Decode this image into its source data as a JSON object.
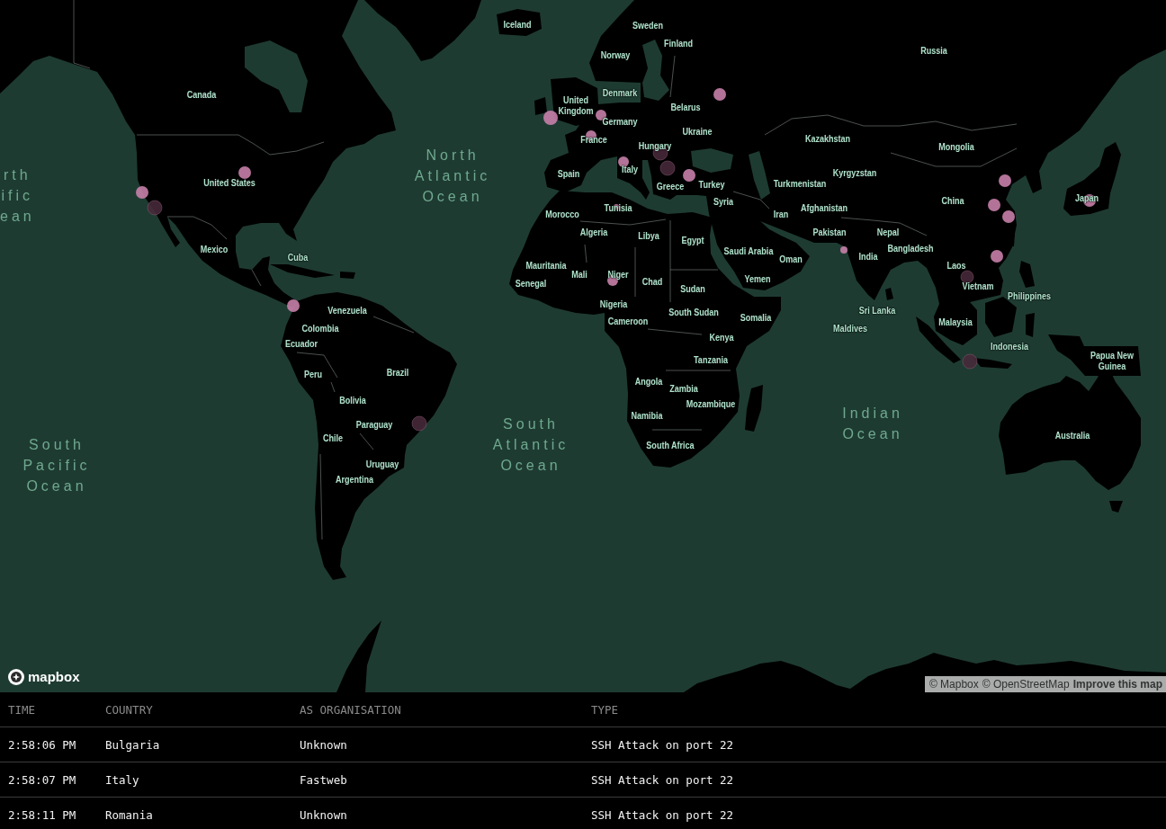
{
  "map": {
    "ocean_labels": [
      "rth ific ean",
      "North Atlantic Ocean",
      "South Pacific Ocean",
      "South Atlantic Ocean",
      "Indian Ocean"
    ],
    "country_labels": [
      "Iceland",
      "Sweden",
      "Finland",
      "Norway",
      "Russia",
      "Canada",
      "Denmark",
      "United Kingdom",
      "Belarus",
      "Germany",
      "Ukraine",
      "France",
      "Kazakhstan",
      "Hungary",
      "Mongolia",
      "Spain",
      "Italy",
      "Kyrgyzstan",
      "United States",
      "Greece",
      "Turkey",
      "Turkmenistan",
      "Syria",
      "China",
      "Japan",
      "Tunisia",
      "Afghanistan",
      "Morocco",
      "Iran",
      "Algeria",
      "Libya",
      "Pakistan",
      "Nepal",
      "Egypt",
      "Mexico",
      "Saudi Arabia",
      "Bangladesh",
      "Cuba",
      "Oman",
      "India",
      "Mauritania",
      "Laos",
      "Mali",
      "Niger",
      "Senegal",
      "Chad",
      "Yemen",
      "Sudan",
      "Vietnam",
      "Philippines",
      "Nigeria",
      "Venezuela",
      "South Sudan",
      "Sri Lanka",
      "Cameroon",
      "Somalia",
      "Malaysia",
      "Colombia",
      "Maldives",
      "Kenya",
      "Ecuador",
      "Indonesia",
      "Tanzania",
      "Papua New Guinea",
      "Peru",
      "Brazil",
      "Angola",
      "Zambia",
      "Bolivia",
      "Mozambique",
      "Namibia",
      "Paraguay",
      "Chile",
      "Australia",
      "South Africa",
      "Uruguay",
      "Argentina"
    ],
    "markers": [
      {
        "faded": false
      },
      {
        "faded": false
      },
      {
        "faded": false
      },
      {
        "faded": false
      },
      {
        "faded": true
      },
      {
        "faded": false
      },
      {
        "faded": true
      },
      {
        "faded": false
      },
      {
        "faded": false
      },
      {
        "faded": false
      },
      {
        "faded": false
      },
      {
        "faded": false
      },
      {
        "faded": false
      },
      {
        "faded": true
      },
      {
        "faded": false
      },
      {
        "faded": false
      },
      {
        "faded": false
      },
      {
        "faded": false
      },
      {
        "faded": true
      },
      {
        "faded": false
      },
      {
        "faded": false
      },
      {
        "faded": true
      },
      {
        "faded": true
      }
    ],
    "logo": {
      "text": "mapbox"
    },
    "attribution": [
      {
        "text": "© Mapbox",
        "kind": "credit"
      },
      {
        "text": "© OpenStreetMap",
        "kind": "credit"
      },
      {
        "text": "Improve this map",
        "kind": "feedback"
      }
    ]
  },
  "table": {
    "columns": [
      "TIME",
      "COUNTRY",
      "AS ORGANISATION",
      "TYPE"
    ],
    "rows": [
      [
        "2:58:06 PM",
        "Bulgaria",
        "Unknown",
        "SSH Attack on port 22"
      ],
      [
        "2:58:07 PM",
        "Italy",
        "Fastweb",
        "SSH Attack on port 22"
      ],
      [
        "2:58:11 PM",
        "Romania",
        "Unknown",
        "SSH Attack on port 22"
      ]
    ]
  }
}
